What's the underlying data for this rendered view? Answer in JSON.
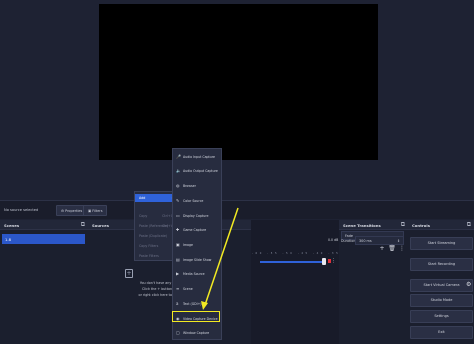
{
  "source_bar": {
    "no_source": "No source selected",
    "properties": "Properties",
    "filters": "Filters"
  },
  "scenes": {
    "title": "Scenes",
    "items": [
      "1.8"
    ]
  },
  "sources": {
    "title": "Sources",
    "empty_line1": "You don't have any sources.",
    "empty_line2": "Click the + button below,",
    "empty_line3": "or right click here to add one."
  },
  "mixer": {
    "db": "0.0 dB",
    "ticks": "-60 -55 -50 -45 -40 -35 -30 -25 -20 -15 -10 -5 0"
  },
  "transitions": {
    "title": "Scene Transitions",
    "type": "Fade",
    "duration_label": "Duration",
    "duration_value": "300 ms"
  },
  "controls": {
    "title": "Controls",
    "buttons": [
      "Start Streaming",
      "Start Recording",
      "Start Virtual Camera",
      "Studio Mode",
      "Settings",
      "Exit"
    ]
  },
  "context_menu": {
    "items": [
      {
        "label": "Add",
        "shortcut": ""
      },
      {
        "label": "Copy",
        "shortcut": "Ctrl+C"
      },
      {
        "label": "Paste (Reference)",
        "shortcut": "Ctrl+V"
      },
      {
        "label": "Paste (Duplicate)",
        "shortcut": ""
      },
      {
        "label": "Copy Filters",
        "shortcut": ""
      },
      {
        "label": "Paste Filters",
        "shortcut": ""
      }
    ]
  },
  "add_submenu": {
    "items": [
      {
        "label": "Audio Input Capture",
        "icon": "microphone-icon"
      },
      {
        "label": "Audio Output Capture",
        "icon": "speaker-icon"
      },
      {
        "label": "Browser",
        "icon": "globe-icon"
      },
      {
        "label": "Color Source",
        "icon": "brush-icon"
      },
      {
        "label": "Display Capture",
        "icon": "monitor-icon"
      },
      {
        "label": "Game Capture",
        "icon": "gamepad-icon"
      },
      {
        "label": "Image",
        "icon": "image-icon"
      },
      {
        "label": "Image Slide Show",
        "icon": "slideshow-icon"
      },
      {
        "label": "Media Source",
        "icon": "play-icon"
      },
      {
        "label": "Scene",
        "icon": "list-icon"
      },
      {
        "label": "Text (GDI+)",
        "icon": "text-icon"
      },
      {
        "label": "Video Capture Device",
        "icon": "camera-icon"
      },
      {
        "label": "Window Capture",
        "icon": "window-icon"
      }
    ]
  },
  "colors": {
    "accent": "#2f62d9",
    "highlight": "#f2ea22",
    "background": "#1e2233"
  }
}
